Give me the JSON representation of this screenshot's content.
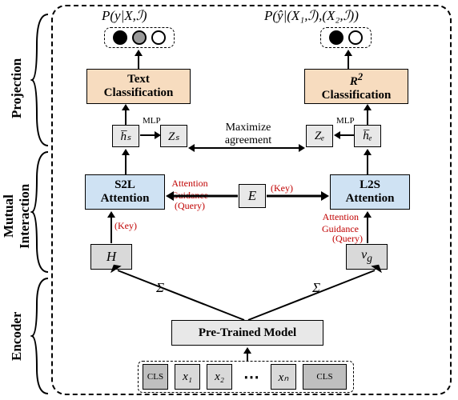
{
  "sections": {
    "projection": "Projection",
    "mutual": "Mutual\nInteraction",
    "encoder": "Encoder"
  },
  "prob": {
    "left": "P(y|X,ℐ)",
    "right": "P(ŷ|(X₁,ℐ),(X₂,ℐ))"
  },
  "top_boxes": {
    "text_cls": "Text\nClassification",
    "r2_cls_r": "R",
    "r2_cls_sup": "2",
    "r2_cls_rest": "Classification"
  },
  "small": {
    "hs": "h̅ₛ",
    "zs": "Zₛ",
    "ze": "Zₑ",
    "he": "h̅ₑ",
    "E": "E",
    "H": "H",
    "vg": "v_g"
  },
  "labels": {
    "maximize": "Maximize\nagreement",
    "mlp_l": "MLP",
    "mlp_r": "MLP",
    "s2l": "S2L\nAttention",
    "l2s": "L2S\nAttention",
    "att_guide": "Attention\nGuidance",
    "query": "(Query)",
    "key_l": "(Key)",
    "key_r": "(Key)",
    "sigma": "Σ",
    "pretrained": "Pre-Trained Model",
    "cls": "CLS",
    "dots": "…"
  },
  "tokens": [
    "x₁",
    "x₂",
    "xₙ"
  ]
}
